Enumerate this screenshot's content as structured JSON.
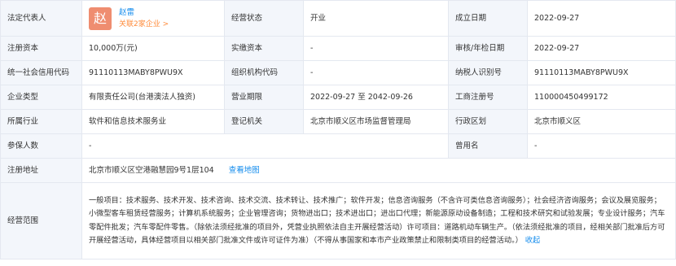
{
  "rows": {
    "r1": {
      "legal_rep_label": "法定代表人",
      "legal_rep_avatar": "赵",
      "legal_rep_name": "赵雷",
      "legal_rep_related": "关联2家企业 >",
      "status_label": "经营状态",
      "status_value": "开业",
      "founded_label": "成立日期",
      "founded_value": "2022-09-27"
    },
    "r2": {
      "reg_capital_label": "注册资本",
      "reg_capital_value": "10,000万(元)",
      "paid_capital_label": "实缴资本",
      "paid_capital_value": "-",
      "approval_label": "审核/年检日期",
      "approval_value": "2022-09-27"
    },
    "r3": {
      "credit_code_label": "统一社会信用代码",
      "credit_code_value": "91110113MABY8PWU9X",
      "org_code_label": "组织机构代码",
      "org_code_value": "-",
      "taxpayer_label": "纳税人识别号",
      "taxpayer_value": "91110113MABY8PWU9X"
    },
    "r4": {
      "type_label": "企业类型",
      "type_value": "有限责任公司(台港澳法人独资)",
      "term_label": "营业期限",
      "term_value": "2022-09-27 至 2042-09-26",
      "reg_no_label": "工商注册号",
      "reg_no_value": "110000450499172"
    },
    "r5": {
      "industry_label": "所属行业",
      "industry_value": "软件和信息技术服务业",
      "authority_label": "登记机关",
      "authority_value": "北京市顺义区市场监督管理局",
      "district_label": "行政区划",
      "district_value": "北京市顺义区"
    },
    "r6": {
      "insured_label": "参保人数",
      "insured_value": "-",
      "former_label": "曾用名",
      "former_value": "-"
    },
    "r7": {
      "address_label": "注册地址",
      "address_value": "北京市顺义区空港融慧园9号1层104",
      "map_link": "查看地图"
    },
    "r8": {
      "scope_label": "经营范围",
      "scope_text": "一般项目：技术服务、技术开发、技术咨询、技术交流、技术转让、技术推广；软件开发；信息咨询服务（不含许可类信息咨询服务）；社会经济咨询服务；会议及展览服务；小微型客车租赁经营服务；计算机系统服务；企业管理咨询；货物进出口；技术进出口；进出口代理；新能源原动设备制造；工程和技术研究和试验发展；专业设计服务；汽车零配件批发；汽车零配件零售。（除依法须经批准的项目外，凭营业执照依法自主开展经营活动）许可项目：道路机动车辆生产。（依法须经批准的项目，经相关部门批准后方可开展经营活动，具体经营项目以相关部门批准文件或许可证件为准）（不得从事国家和本市产业政策禁止和限制类项目的经营活动。）",
      "collapse_link": "收起"
    }
  }
}
